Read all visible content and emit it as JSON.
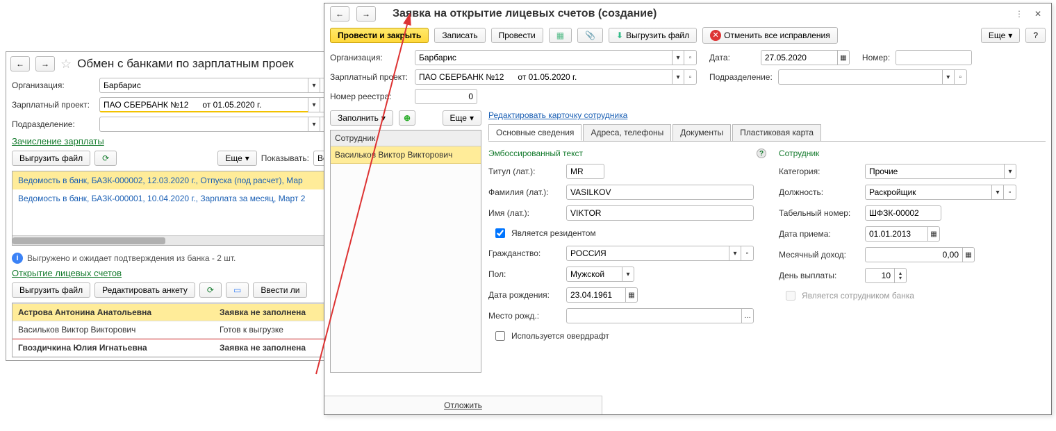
{
  "left": {
    "title": "Обмен с банками по зарплатным проек",
    "org_label": "Организация:",
    "org_value": "Барбарис",
    "proj_label": "Зарплатный проект:",
    "proj_value": "ПАО СБЕРБАНК №12      от 01.05.2020 г.",
    "dept_label": "Подразделение:",
    "section_credit": "Зачисление зарплаты",
    "btn_upload": "Выгрузить файл",
    "btn_more": "Еще",
    "show_label": "Показывать:",
    "show_value": "Вс",
    "list": [
      "Ведомость в банк, БАЗК-000002, 12.03.2020 г., Отпуска (под расчет), Мар",
      "Ведомость в банк, БАЗК-000001, 10.04.2020 г., Зарплата за месяц, Март 2"
    ],
    "info_msg": "Выгружено и ожидает подтверждения из банка - 2 шт.",
    "section_open": "Открытие лицевых счетов",
    "btn_edit_form": "Редактировать анкету",
    "btn_enter": "Ввести ли",
    "grid": [
      {
        "name": "Астрова Антонина Анатольевна",
        "status": "Заявка не заполнена",
        "hl": true
      },
      {
        "name": "Васильков Виктор Викторович",
        "status": "Готов к выгрузке",
        "redline": true
      },
      {
        "name": "Гвоздичкина Юлия Игнатьевна",
        "status": "Заявка не заполнена",
        "bold": true
      }
    ],
    "footer_defer": "Отложить"
  },
  "right": {
    "title": "Заявка на открытие лицевых счетов (создание)",
    "btn_post_close": "Провести и закрыть",
    "btn_save": "Записать",
    "btn_post": "Провести",
    "btn_upload": "Выгрузить файл",
    "btn_cancel_fix": "Отменить все исправления",
    "btn_more": "Еще",
    "org_label": "Организация:",
    "org_value": "Барбарис",
    "date_label": "Дата:",
    "date_value": "27.05.2020",
    "num_label": "Номер:",
    "proj_label": "Зарплатный проект:",
    "proj_value": "ПАО СБЕРБАНК №12      от 01.05.2020 г.",
    "dept_label": "Подразделение:",
    "reg_label": "Номер реестра:",
    "reg_value": "0",
    "btn_fill": "Заполнить",
    "link_edit_card": "Редактировать карточку сотрудника",
    "emp_header": "Сотрудник",
    "emp_item": "Васильков Виктор Викторович",
    "tabs": [
      "Основные сведения",
      "Адреса, телефоны",
      "Документы",
      "Пластиковая карта"
    ],
    "emb_title": "Эмбоссированный текст",
    "emp_title": "Сотрудник",
    "title_lat_label": "Титул (лат.):",
    "title_lat": "MR",
    "surname_lat_label": "Фамилия (лат.):",
    "surname_lat": "VASILKOV",
    "name_lat_label": "Имя (лат.):",
    "name_lat": "VIKTOR",
    "resident_label": "Является резидентом",
    "citizen_label": "Гражданство:",
    "citizen": "РОССИЯ",
    "sex_label": "Пол:",
    "sex": "Мужской",
    "birth_label": "Дата рождения:",
    "birth": "23.04.1961",
    "birthplace_label": "Место рожд.:",
    "overdraft_label": "Используется овердрафт",
    "cat_label": "Категория:",
    "cat": "Прочие",
    "pos_label": "Должность:",
    "pos": "Раскройщик",
    "tab_num_label": "Табельный номер:",
    "tab_num": "ШФЗК-00002",
    "hire_label": "Дата приема:",
    "hire": "01.01.2013",
    "income_label": "Месячный доход:",
    "income": "0,00",
    "payday_label": "День выплаты:",
    "payday": "10",
    "bank_emp_label": "Является сотрудником банка"
  }
}
